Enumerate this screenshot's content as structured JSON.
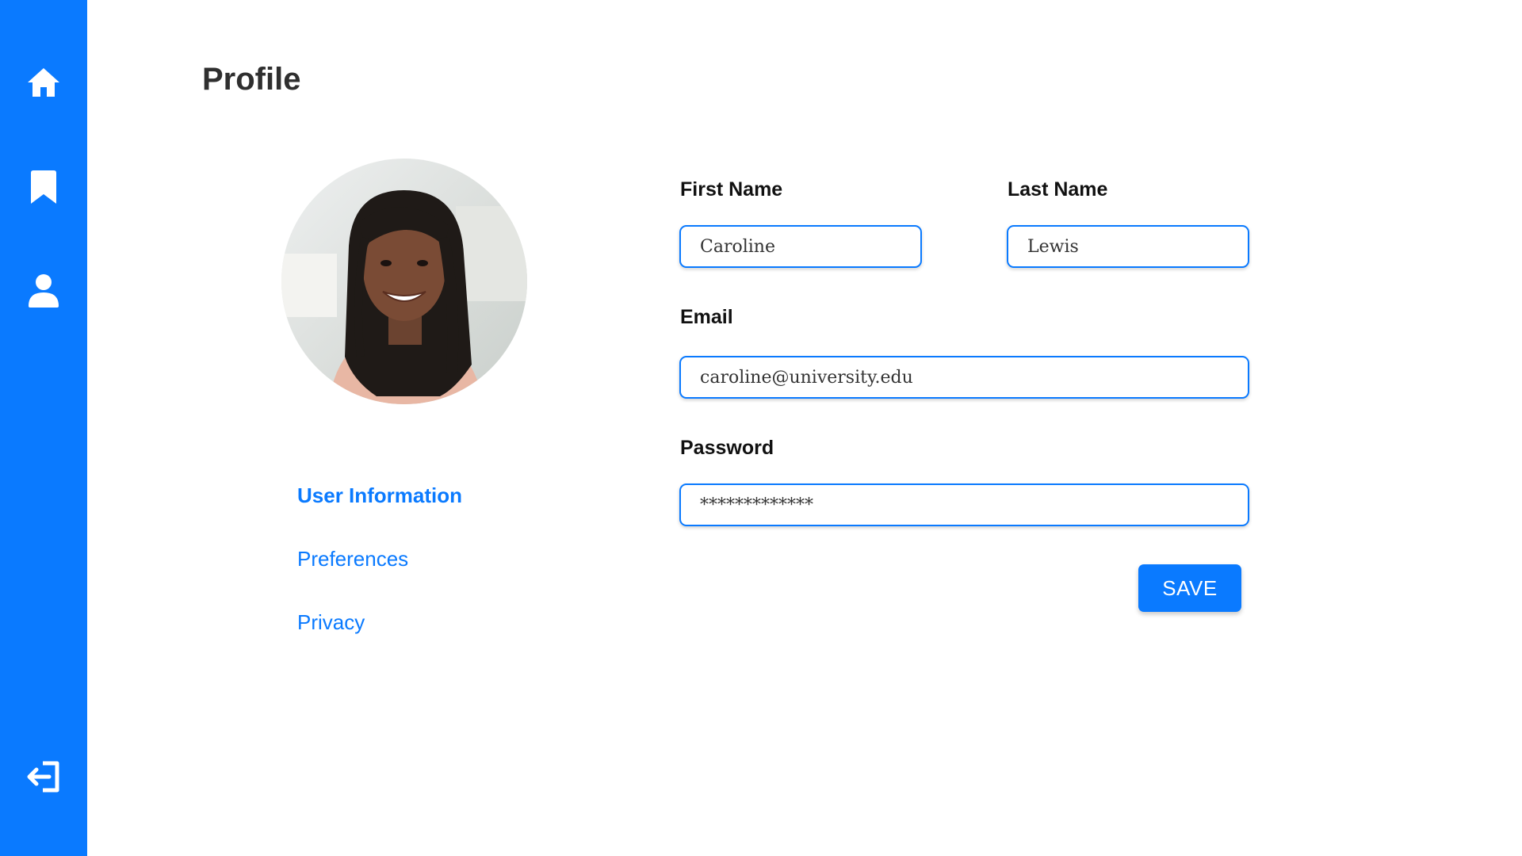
{
  "sidebar": {
    "background": "#0a7aff",
    "icons": [
      "home-icon",
      "bookmark-icon",
      "user-icon",
      "logout-icon"
    ]
  },
  "page": {
    "title": "Profile"
  },
  "profile_menu": {
    "items": [
      {
        "label": "User Information",
        "active": true
      },
      {
        "label": "Preferences",
        "active": false
      },
      {
        "label": "Privacy",
        "active": false
      }
    ]
  },
  "form": {
    "first_name": {
      "label": "First Name",
      "value": "Caroline"
    },
    "last_name": {
      "label": "Last Name",
      "value": "Lewis"
    },
    "email": {
      "label": "Email",
      "value": "caroline@university.edu"
    },
    "password": {
      "label": "Password",
      "value": "*************"
    },
    "save_label": "SAVE"
  },
  "colors": {
    "accent": "#0a7aff",
    "text": "#2f2f2f"
  }
}
